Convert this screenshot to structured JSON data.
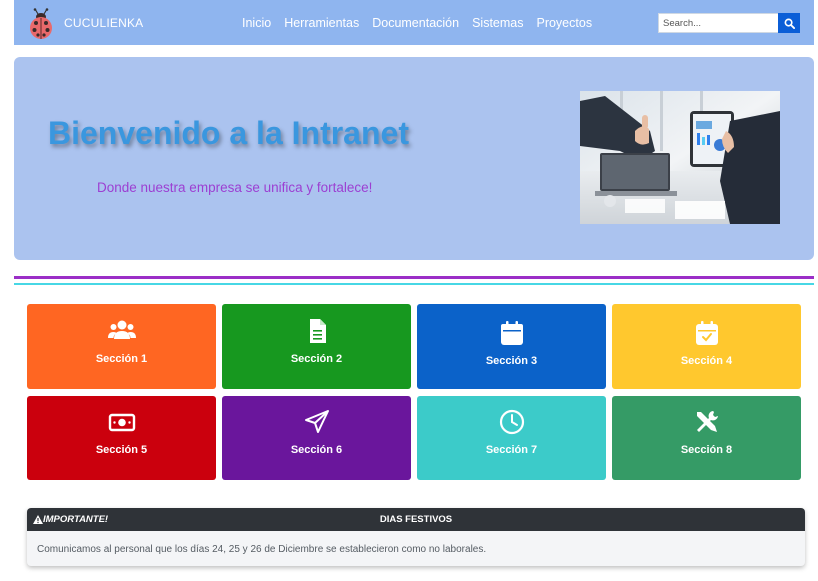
{
  "navbar": {
    "brand": "CUCULIENKA",
    "links": [
      "Inicio",
      "Herramientas",
      "Documentación",
      "Sistemas",
      "Proyectos"
    ],
    "search_placeholder": "Search..."
  },
  "hero": {
    "title": "Bienvenido a la Intranet",
    "subtitle": "Donde nuestra empresa se unifica y fortalece!"
  },
  "sections": [
    {
      "label": "Sección 1",
      "icon": "users-icon",
      "color": "#ff6622"
    },
    {
      "label": "Sección 2",
      "icon": "document-icon",
      "color": "#17981f"
    },
    {
      "label": "Sección 3",
      "icon": "calendar-icon",
      "color": "#0b62c9"
    },
    {
      "label": "Sección 4",
      "icon": "calendar-check-icon",
      "color": "#ffc82e"
    },
    {
      "label": "Sección 5",
      "icon": "money-icon",
      "color": "#cb000d"
    },
    {
      "label": "Sección 6",
      "icon": "paper-plane-icon",
      "color": "#6a169c"
    },
    {
      "label": "Sección 7",
      "icon": "clock-icon",
      "color": "#3ccbc9"
    },
    {
      "label": "Sección 8",
      "icon": "tools-icon",
      "color": "#359b66"
    }
  ],
  "notice": {
    "important_label": "IMPORTANTE!",
    "title": "DIAS FESTIVOS",
    "message": "Comunicamos al personal que los días 24, 25 y 26 de Diciembre se establecieron como no laborales."
  },
  "colors": {
    "navbar": "#8fb5ef",
    "hero_bg": "#abc3ef",
    "hero_title": "#3a97df",
    "hero_subtitle": "#9c3fd2",
    "divider_purple": "#9b2fc7",
    "divider_cyan": "#47d7e5",
    "search_button": "#0b5ed7",
    "notice_header": "#2f3338"
  }
}
